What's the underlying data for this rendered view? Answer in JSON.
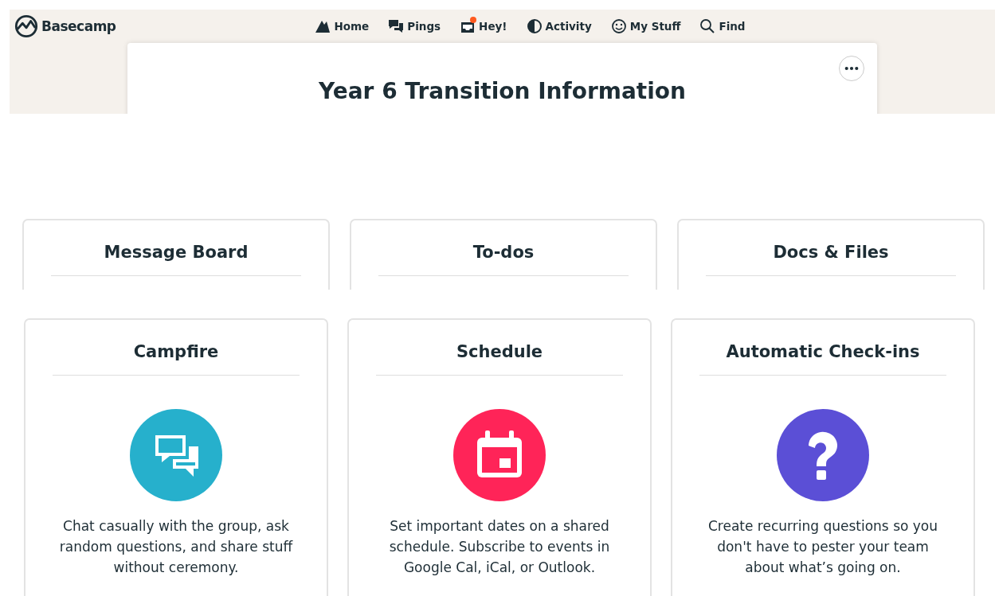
{
  "brand": "Basecamp",
  "nav": [
    {
      "label": "Home",
      "kind": "home",
      "badge": false
    },
    {
      "label": "Pings",
      "kind": "pings",
      "badge": false
    },
    {
      "label": "Hey!",
      "kind": "hey",
      "badge": true
    },
    {
      "label": "Activity",
      "kind": "activity",
      "badge": false
    },
    {
      "label": "My Stuff",
      "kind": "mystuff",
      "badge": false
    },
    {
      "label": "Find",
      "kind": "find",
      "badge": false
    }
  ],
  "project": {
    "title": "Year 6 Transition Information"
  },
  "tools_top": [
    {
      "title": "Message Board"
    },
    {
      "title": "To-dos"
    },
    {
      "title": "Docs & Files"
    }
  ],
  "tools": [
    {
      "title": "Campfire",
      "kind": "chat",
      "color": "#26b0cc",
      "description": "Chat casually with the group, ask random questions, and share stuff without ceremony."
    },
    {
      "title": "Schedule",
      "kind": "calendar",
      "color": "#ff2458",
      "description": "Set important dates on a shared schedule. Subscribe to events in Google Cal, iCal, or Outlook."
    },
    {
      "title": "Automatic Check-ins",
      "kind": "question",
      "color": "#5b4fd6",
      "description": "Create recurring questions so you don't have to pester your team about what’s going on."
    }
  ]
}
